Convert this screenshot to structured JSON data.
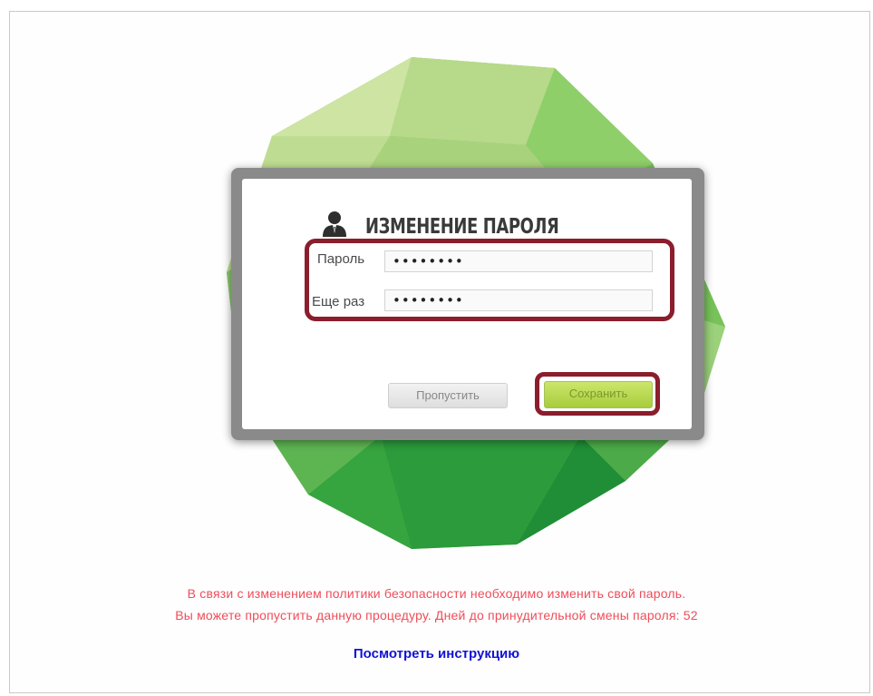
{
  "dialog": {
    "title": "ИЗМЕНЕНИЕ ПАРОЛЯ",
    "password_label": "Пароль",
    "password_value": "••••••••",
    "repeat_label": "Еще раз",
    "repeat_value": "••••••••",
    "skip_button": "Пропустить",
    "save_button": "Сохранить"
  },
  "notice": {
    "line1": "В связи с изменением политики безопасности необходимо изменить свой пароль.",
    "line2": "Вы можете пропустить данную процедуру. Дней до принудительной смены пароля: 52"
  },
  "instruction_link": "Посмотреть инструкцию",
  "icons": {
    "title_icon": "user-icon"
  },
  "colors": {
    "highlight": "#8b1d2c",
    "notice": "#ee4d5a",
    "link": "#1212d6",
    "save_button": "#b8d84f",
    "green_dark": "#1f9a3c",
    "green_light": "#cfe59a"
  }
}
